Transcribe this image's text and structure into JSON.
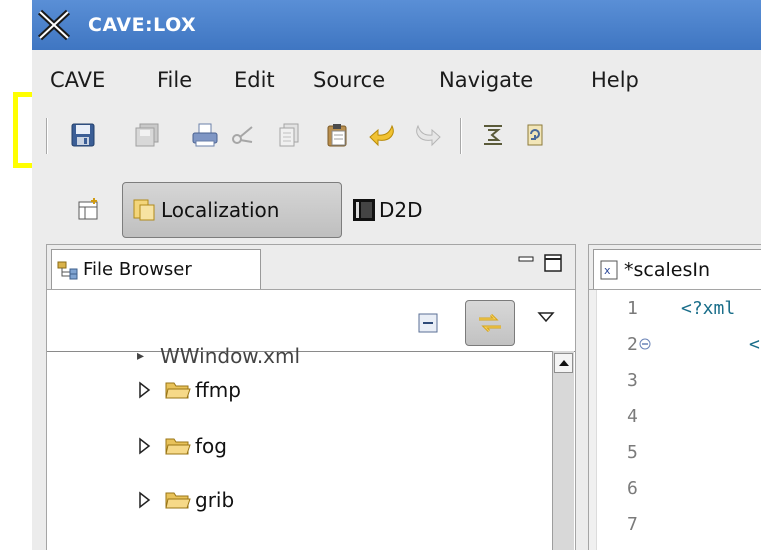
{
  "app": {
    "title": "CAVE:LOX"
  },
  "menu": [
    "CAVE",
    "File",
    "Edit",
    "Source",
    "Navigate",
    "Help"
  ],
  "toolbar": {
    "buttons": [
      "save-icon",
      "save-all-icon",
      "print-icon",
      "cut-icon",
      "copy-icon",
      "paste-icon",
      "undo-icon",
      "redo-icon",
      "outline-icon",
      "refresh-icon"
    ]
  },
  "perspectives": {
    "open_perspective_icon": "open-perspective-icon",
    "active": "Localization",
    "other": "D2D"
  },
  "file_browser": {
    "tab_title": "File Browser",
    "partial_row": "WWindow.xml",
    "items": [
      {
        "label": "ffmp"
      },
      {
        "label": "fog"
      },
      {
        "label": "grib"
      }
    ]
  },
  "editor": {
    "tab_title": "*scalesIn",
    "line_numbers": [
      "1",
      "2",
      "3",
      "4",
      "5",
      "6",
      "7"
    ],
    "lines": [
      "<?xml",
      "<"
    ]
  },
  "colors": {
    "titlebar": "#4a82cc",
    "highlight": "#ffff00"
  }
}
